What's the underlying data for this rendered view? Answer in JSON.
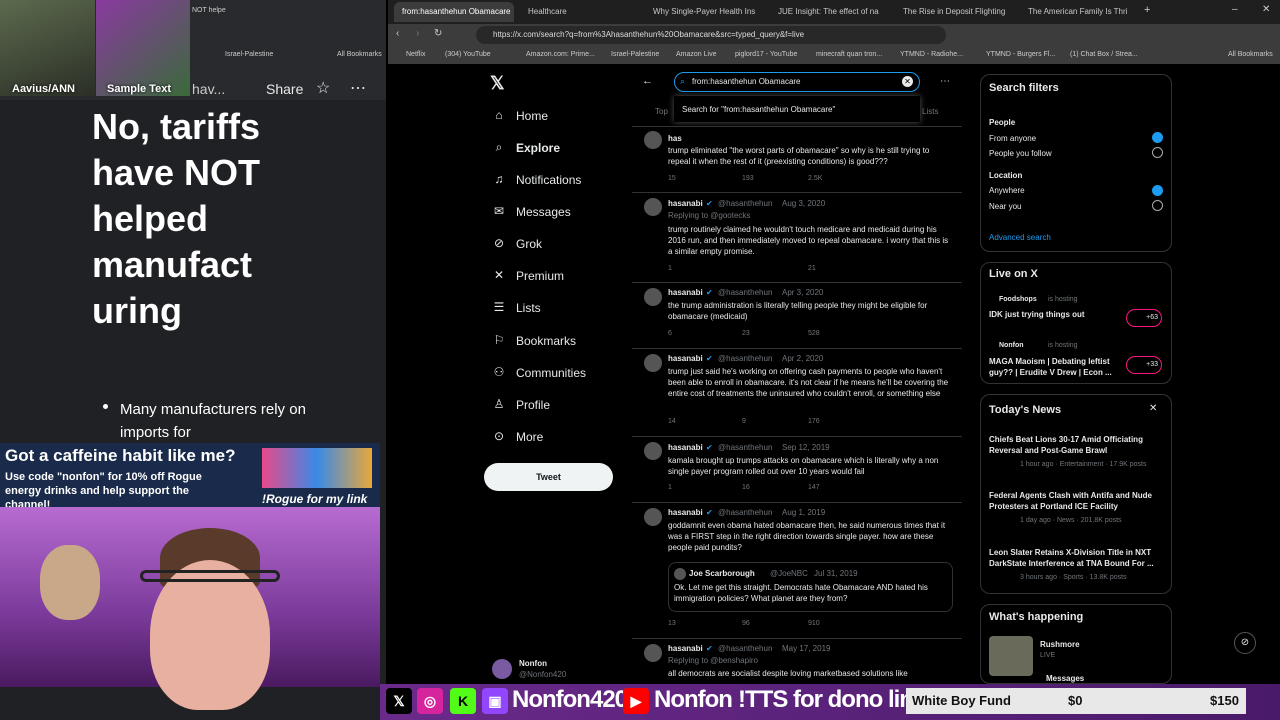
{
  "stream": {
    "cam1_label": "Aavius/ANN",
    "cam2_label": "Sample Text",
    "doc_header_partial": "hav...",
    "share_label": "Share",
    "doc_title": "No, tariffs have NOT helped manufact uring",
    "doc_bullet": "Many manufacturers rely on imports for",
    "ad_line1": "Got a caffeine habit like me?",
    "ad_line2": "Use code \"nonfon\" for 10% off Rogue energy drinks and help support the channel!",
    "ad_line3": "!Rogue for my link",
    "handle": "Nonfon420",
    "handle2": "Nonfon",
    "tts": "!TTS for dono link",
    "fund_name": "White Boy Fund",
    "fund_current": "$0",
    "fund_goal": "$150"
  },
  "browser": {
    "left_tab": "NOT helpe",
    "tabs": [
      "from:hasanthehun Obamacare",
      "Healthcare",
      "Why Single-Payer Health Ins",
      "JUE Insight: The effect of na",
      "The Rise in Deposit Flighting",
      "The American Family Is Thri"
    ],
    "url": "https://x.com/search?q=from%3Ahasanthehun%20Obamacare&src=typed_query&f=live",
    "bookmarks": [
      "Netflix",
      "(304) YouTube",
      "Amazon.com: Prime...",
      "Israel-Palestine",
      "Amazon Live",
      "piglord17 - YouTube",
      "minecraft quan tron...",
      "YTMND - Radiohe...",
      "YTMND - Burgers Fl...",
      "(1) Chat Box / Strea...",
      "All Bookmarks"
    ],
    "left_bookmarks": [
      "Israel-Palestine",
      "All Bookmarks"
    ]
  },
  "nav": {
    "items": [
      "Home",
      "Explore",
      "Notifications",
      "Messages",
      "Grok",
      "Premium",
      "Lists",
      "Bookmarks",
      "Communities",
      "Profile",
      "More"
    ],
    "tweet_button": "Tweet",
    "account_name": "Nonfon",
    "account_handle": "@Nonfon420"
  },
  "search": {
    "query": "from:hasanthehun Obamacare",
    "suggestion": "Search for \"from:hasanthehun Obamacare\"",
    "tab_top": "Top",
    "tab_lists": "Lists"
  },
  "tweets": [
    {
      "name": "has",
      "handle": "",
      "date": "",
      "reply": "",
      "text": "trump eliminated \"the worst parts of obamacare\" so why is he still trying to repeal it when the rest of it (preexisting conditions) is good???",
      "replies": "15",
      "rts": "193",
      "likes": "2.5K"
    },
    {
      "name": "hasanabi",
      "handle": "@hasanthehun",
      "date": "Aug 3, 2020",
      "reply": "Replying to @gootecks",
      "text": "trump routinely claimed he wouldn't touch medicare and medicaid during his 2016 run, and then immediately moved to repeal obamacare. i worry that this is a similar empty promise.",
      "replies": "1",
      "rts": "",
      "likes": "21"
    },
    {
      "name": "hasanabi",
      "handle": "@hasanthehun",
      "date": "Apr 3, 2020",
      "reply": "",
      "text": "the trump administration is literally telling people they might be eligible for obamacare (medicaid)",
      "replies": "6",
      "rts": "23",
      "likes": "528"
    },
    {
      "name": "hasanabi",
      "handle": "@hasanthehun",
      "date": "Apr 2, 2020",
      "reply": "",
      "text": "trump just said he's working on offering cash payments to people who haven't been able to enroll in obamacare. it's not clear if he means he'll be covering the entire cost of treatments the uninsured who couldn't enroll, or something else",
      "replies": "14",
      "rts": "9",
      "likes": "176"
    },
    {
      "name": "hasanabi",
      "handle": "@hasanthehun",
      "date": "Sep 12, 2019",
      "reply": "",
      "text": "kamala brought up trumps attacks on obamacare which is literally why a non single payer program rolled out over 10 years would fail",
      "replies": "1",
      "rts": "16",
      "likes": "147"
    },
    {
      "name": "hasanabi",
      "handle": "@hasanthehun",
      "date": "Aug 1, 2019",
      "reply": "",
      "text": "goddamnit even obama hated obamacare then, he said numerous times that it was a FIRST step in the right direction towards single payer. how are these people paid pundits?",
      "replies": "13",
      "rts": "96",
      "likes": "910"
    },
    {
      "name": "hasanabi",
      "handle": "@hasanthehun",
      "date": "May 17, 2019",
      "reply": "Replying to @benshapiro",
      "text": "all democrats are socialist despite loving marketbased solutions like",
      "replies": "",
      "rts": "",
      "likes": ""
    }
  ],
  "quote": {
    "name": "Joe Scarborough",
    "handle": "@JoeNBC",
    "date": "Jul 31, 2019",
    "text": "Ok. Let me get this straight. Democrats hate Obamacare AND hated his immigration policies? What planet are they from?"
  },
  "filters": {
    "title": "Search filters",
    "people_label": "People",
    "people_options": [
      "From anyone",
      "People you follow"
    ],
    "location_label": "Location",
    "location_options": [
      "Anywhere",
      "Near you"
    ],
    "advanced": "Advanced search"
  },
  "live": {
    "title": "Live on X",
    "items": [
      {
        "host": "Foodshops",
        "status": "is hosting",
        "title": "IDK just trying things out",
        "count": "+63"
      },
      {
        "host": "Nonfon",
        "status": "is hosting",
        "title": "MAGA Maoism | Debating leftist guy?? | Erudite V Drew | Econ ...",
        "count": "+33"
      }
    ]
  },
  "news": {
    "title": "Today's News",
    "items": [
      {
        "title": "Chiefs Beat Lions 30-17 Amid Officiating Reversal and Post-Game Brawl",
        "meta": "1 hour ago · Entertainment · 17.9K posts"
      },
      {
        "title": "Federal Agents Clash with Antifa and Nude Protesters at Portland ICE Facility",
        "meta": "1 day ago · News · 201.8K posts"
      },
      {
        "title": "Leon Slater Retains X-Division Title in NXT DarkState Interference at TNA Bound For ...",
        "meta": "3 hours ago · Sports · 13.8K posts"
      }
    ]
  },
  "happening": {
    "title": "What's happening",
    "item": "Rushmore",
    "item_meta": "LIVE",
    "messages": "Messages"
  }
}
